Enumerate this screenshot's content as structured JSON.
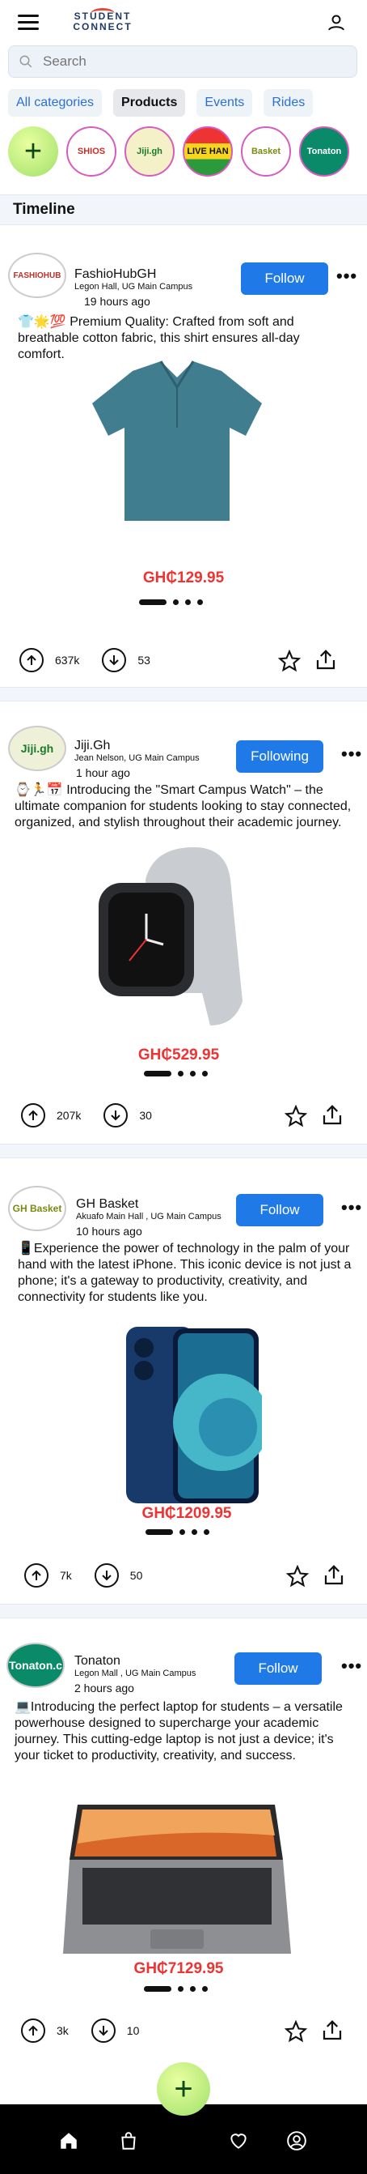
{
  "app": {
    "logo_line1": "STUDENT",
    "logo_line2": "CONNECT"
  },
  "search": {
    "placeholder": "Search"
  },
  "categories": [
    {
      "label": "All categories",
      "active": false
    },
    {
      "label": "Products",
      "active": true
    },
    {
      "label": "Events",
      "active": false
    },
    {
      "label": "Rides",
      "active": false
    }
  ],
  "stories": [
    {
      "label": "SHIOS"
    },
    {
      "label": "Jiji.gh"
    },
    {
      "label": "LIVE HAN"
    },
    {
      "label": "Basket"
    },
    {
      "label": "Tonaton"
    }
  ],
  "timeline": {
    "title": "Timeline"
  },
  "posts": [
    {
      "name": "FashioHubGH",
      "location": "Legon Hall, UG Main Campus",
      "time": "19 hours ago",
      "follow": "Follow",
      "avatar_text": "FASHIOHUB",
      "description": "👕🌟💯 Premium Quality: Crafted from soft and breathable cotton fabric, this shirt ensures all-day comfort.",
      "price": "GH₵129.95",
      "upvotes": "637k",
      "downvotes": "53"
    },
    {
      "name": "Jiji.Gh",
      "location": "Jean Nelson, UG Main Campus",
      "time": "1 hour ago",
      "follow": "Following",
      "avatar_text": "Jiji.gh",
      "description": "⌚🏃📅 Introducing the \"Smart Campus Watch\" – the ultimate companion for students looking to stay connected, organized, and stylish throughout their academic journey.",
      "price": "GH₵529.95",
      "upvotes": "207k",
      "downvotes": "30"
    },
    {
      "name": "GH Basket",
      "location": "Akuafo Main Hall , UG Main Campus",
      "time": "10 hours ago",
      "follow": "Follow",
      "avatar_text": "GH Basket",
      "description": "📱Experience the power of technology in the palm of your hand with the latest iPhone. This iconic device is not just a phone; it's a gateway to productivity, creativity, and connectivity for students like you.",
      "price": "GH₵1209.95",
      "upvotes": "7k",
      "downvotes": "50"
    },
    {
      "name": "Tonaton",
      "location": "Legon Mall , UG Main Campus",
      "time": "2 hours ago",
      "follow": "Follow",
      "avatar_text": "Tonaton.c",
      "description": "💻Introducing the perfect laptop for students – a versatile powerhouse designed to supercharge your academic journey. This cutting-edge laptop is not just a device; it's your ticket to productivity, creativity, and success.",
      "price": "GH₵7129.95",
      "upvotes": "3k",
      "downvotes": "10"
    }
  ],
  "colors": {
    "accent": "#1f7ae8",
    "price": "#ee3333",
    "fab": "#9fe06a"
  },
  "icons": [
    "menu-icon",
    "user-icon",
    "search-icon",
    "plus-icon",
    "upvote-icon",
    "downvote-icon",
    "star-icon",
    "share-icon",
    "home-icon",
    "bag-icon",
    "heart-icon",
    "profile-icon"
  ]
}
